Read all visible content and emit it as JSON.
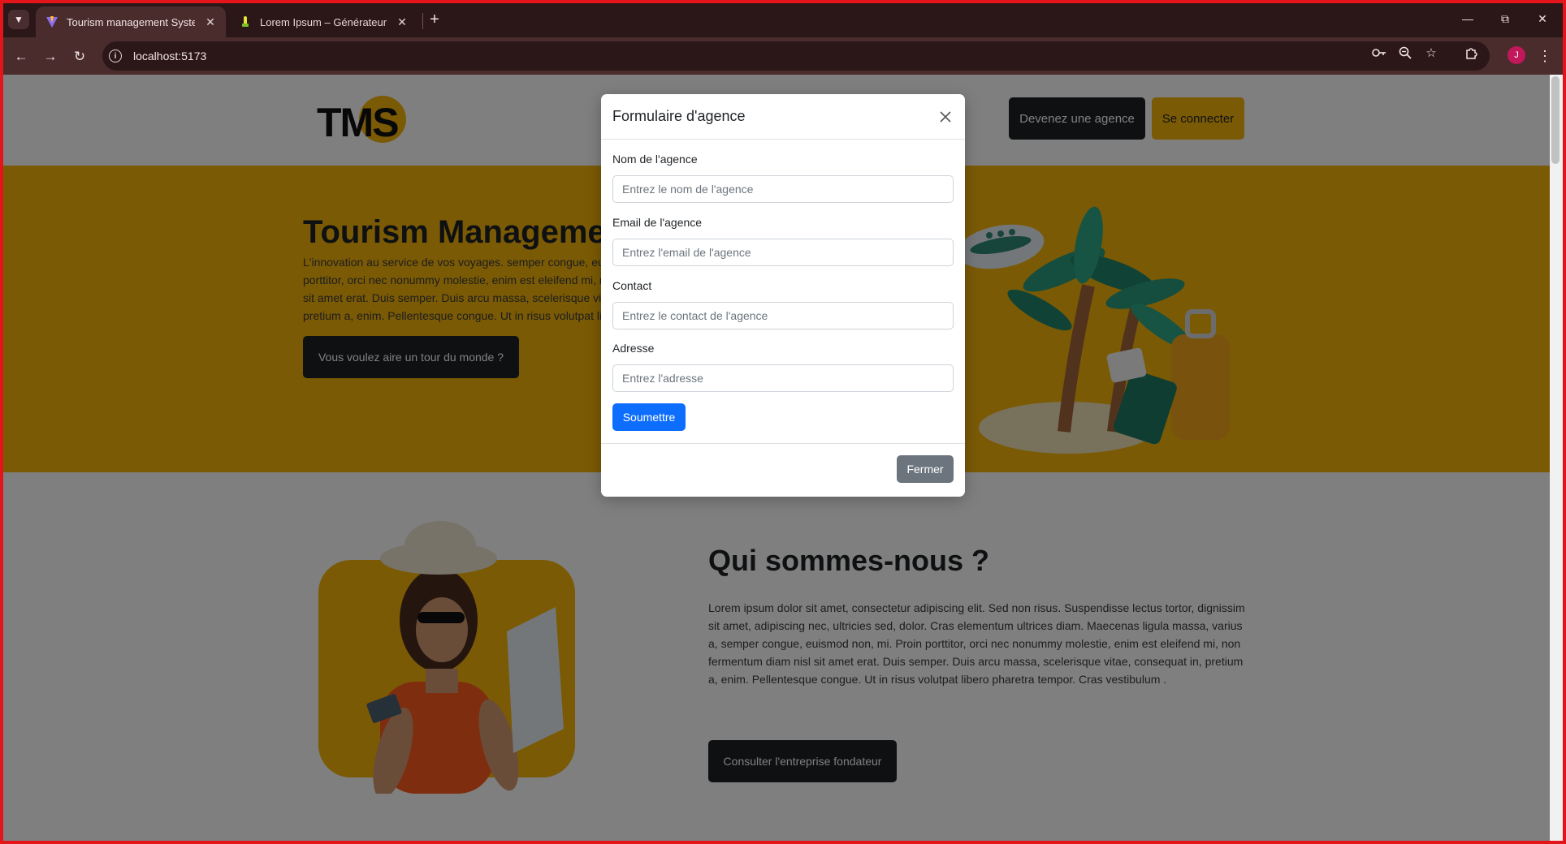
{
  "browser": {
    "tabs": [
      {
        "title": "Tourism management System",
        "active": true
      },
      {
        "title": "Lorem Ipsum – Générateur, Ori",
        "active": false
      }
    ],
    "url": "localhost:5173",
    "profile_initial": "J"
  },
  "header": {
    "logo_text": "TMS",
    "agency_button": "Devenez une agence",
    "login_button": "Se connecter"
  },
  "hero": {
    "title": "Tourism Management",
    "text": "L'innovation au service de vos voyages. semper congue, euismod non, mi. Proin porttitor, orci nec nonummy molestie, enim est eleifend mi, non fermentum diam nisl sit amet erat. Duis semper. Duis arcu massa, scelerisque vitae, consequat in, pretium a, enim. Pellentesque congue. Ut in risus volutpat libero pharetra tempor.",
    "button": "Vous voulez aire un tour du monde ?"
  },
  "about": {
    "title": "Qui sommes-nous ?",
    "text": "Lorem ipsum dolor sit amet, consectetur adipiscing elit. Sed non risus. Suspendisse lectus tortor, dignissim sit amet, adipiscing nec, ultricies sed, dolor. Cras elementum ultrices diam. Maecenas ligula massa, varius a, semper congue, euismod non, mi. Proin porttitor, orci nec nonummy molestie, enim est eleifend mi, non fermentum diam nisl sit amet erat. Duis semper. Duis arcu massa, scelerisque vitae, consequat in, pretium a, enim. Pellentesque congue. Ut in risus volutpat libero pharetra tempor. Cras vestibulum .",
    "button": "Consulter l'entreprise fondateur"
  },
  "modal": {
    "title": "Formulaire d'agence",
    "fields": {
      "name": {
        "label": "Nom de l'agence",
        "placeholder": "Entrez le nom de l'agence",
        "value": ""
      },
      "email": {
        "label": "Email de l'agence",
        "placeholder": "Entrez l'email de l'agence",
        "value": ""
      },
      "contact": {
        "label": "Contact",
        "placeholder": "Entrez le contact de l'agence",
        "value": ""
      },
      "address": {
        "label": "Adresse",
        "placeholder": "Entrez l'adresse",
        "value": ""
      }
    },
    "submit_button": "Soumettre",
    "close_button": "Fermer"
  },
  "colors": {
    "brand_yellow": "#f5b40a",
    "dark": "#1d2125",
    "primary_blue": "#0d6efd",
    "secondary_gray": "#6c757d",
    "browser_frame": "#2b1718",
    "browser_toolbar": "#4a2c2d"
  },
  "icons": {
    "tab_menu": "chevron-down-icon",
    "new_tab": "plus-icon",
    "back": "arrow-left-icon",
    "forward": "arrow-right-icon",
    "reload": "reload-icon",
    "site_info": "info-icon",
    "password": "key-icon",
    "zoom": "zoom-icon",
    "bookmark": "star-icon",
    "extensions": "puzzle-icon",
    "menu": "kebab-menu-icon",
    "modal_close": "close-icon"
  }
}
